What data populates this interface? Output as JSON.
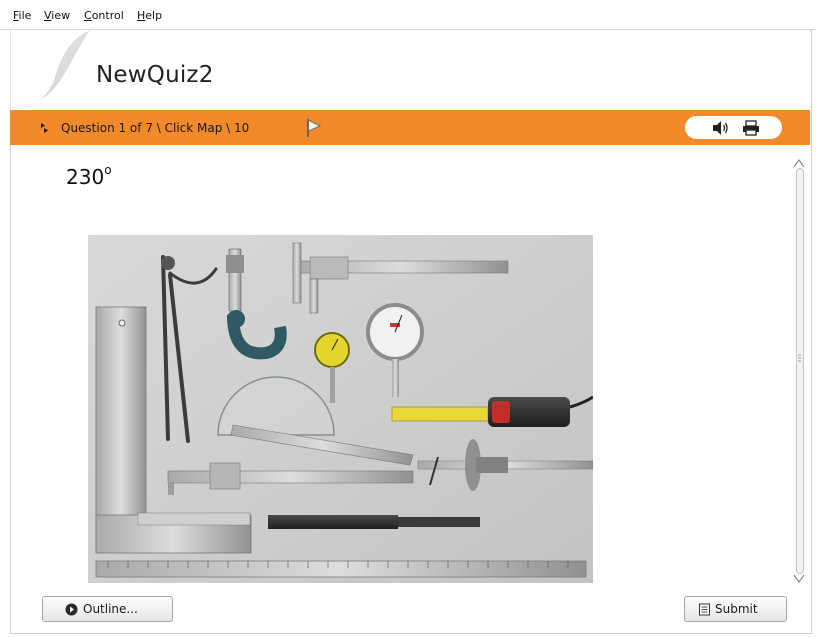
{
  "menu": {
    "items": [
      {
        "label": "File"
      },
      {
        "label": "View"
      },
      {
        "label": "Control"
      },
      {
        "label": "Help"
      }
    ]
  },
  "header": {
    "title": "NewQuiz2"
  },
  "navbar": {
    "breadcrumb": "Question 1 of 7 \\ Click Map \\ 10"
  },
  "question": {
    "text": "230",
    "superscript": "o"
  },
  "buttons": {
    "outline": "Outline...",
    "submit": "Submit"
  },
  "colors": {
    "accent": "#f28a2b",
    "page_bg": "#ffffff",
    "frame_border": "#cfcfcf"
  },
  "icons": {
    "breadcrumb": "chevron-right-icon",
    "flag": "flag-icon",
    "audio": "speaker-icon",
    "print": "printer-icon",
    "outline": "circle-arrow-icon",
    "submit": "document-icon"
  }
}
